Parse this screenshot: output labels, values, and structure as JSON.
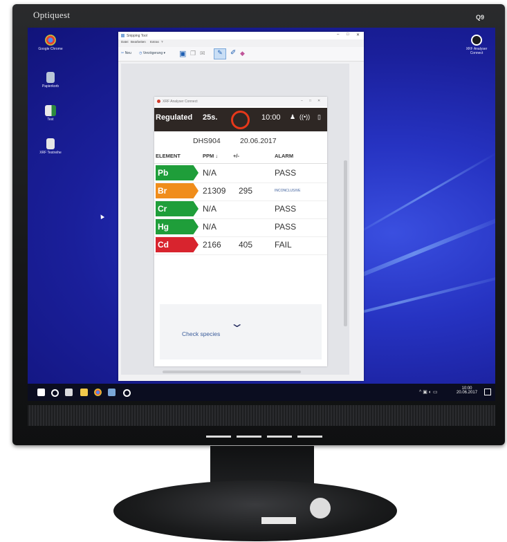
{
  "monitor": {
    "brand": "Optiquest",
    "model": "Q9"
  },
  "desktop": {
    "icons": [
      {
        "label": "Google Chrome",
        "name": "chrome-icon"
      },
      {
        "label": "Papierkorb",
        "name": "recycle-bin-icon"
      },
      {
        "label": "Test",
        "name": "test-file-icon"
      },
      {
        "label": "XRF Testreihe",
        "name": "testreihe-file-icon"
      }
    ],
    "right_icon": {
      "label": "XRF Analyser Connect",
      "name": "xrf-analyser-icon"
    }
  },
  "snipping_tool": {
    "title": "Snipping Tool",
    "menu": [
      "Datei",
      "Bearbeiten",
      "Extras",
      "?"
    ],
    "toolbar": [
      "Neu",
      "Verzögerung"
    ]
  },
  "app": {
    "title": "XRF Analyser Connect",
    "status": {
      "mode": "Regulated",
      "seconds": "25s.",
      "time": "10:00"
    },
    "sample_id": "DHS904",
    "date": "20.06.2017",
    "columns": [
      "ELEMENT",
      "PPM ↓",
      "+/-",
      "ALARM"
    ],
    "rows": [
      {
        "element": "Pb",
        "ppm": "N/A",
        "err": "",
        "alarm": "PASS",
        "color": "#1f9e3a"
      },
      {
        "element": "Br",
        "ppm": "21309",
        "err": "295",
        "alarm": "INCONCLUSIVE",
        "color": "#f08d1b"
      },
      {
        "element": "Cr",
        "ppm": "N/A",
        "err": "",
        "alarm": "PASS",
        "color": "#1f9e3a"
      },
      {
        "element": "Hg",
        "ppm": "N/A",
        "err": "",
        "alarm": "PASS",
        "color": "#1f9e3a"
      },
      {
        "element": "Cd",
        "ppm": "2166",
        "err": "405",
        "alarm": "FAIL",
        "color": "#d8242e"
      }
    ],
    "check_species": "Check species"
  },
  "taskbar": {
    "date": "20.06.2017",
    "time": "10:00"
  }
}
